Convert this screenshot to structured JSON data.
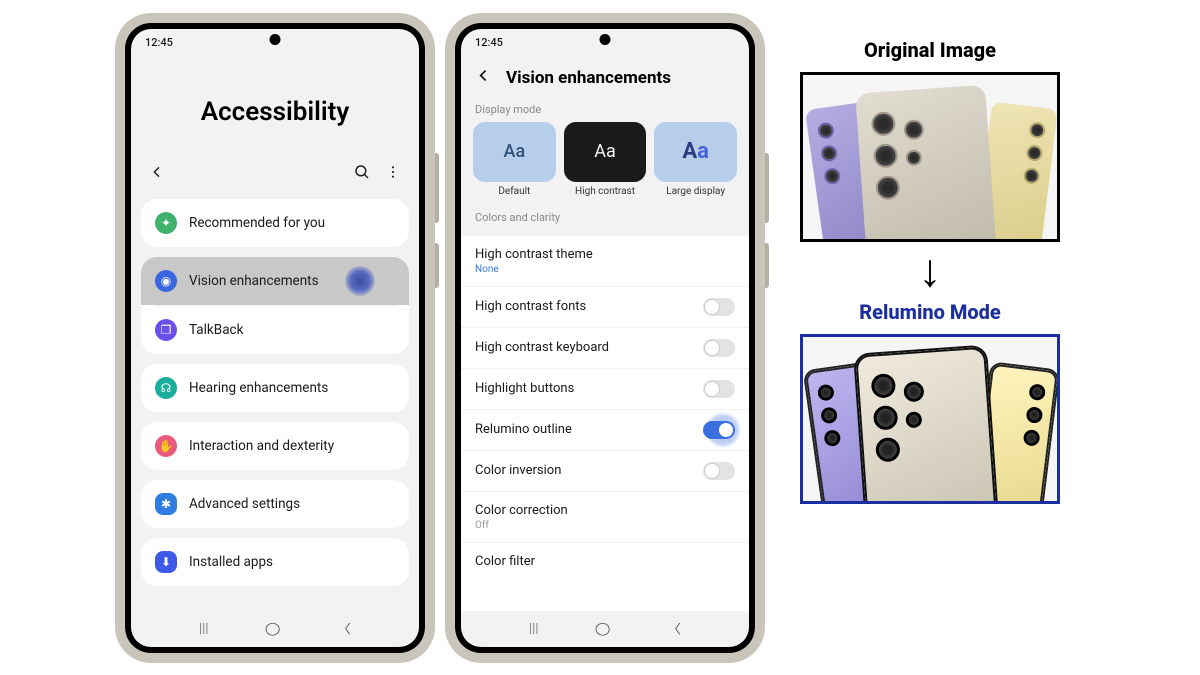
{
  "status_time": "12:45",
  "screen1": {
    "title": "Accessibility",
    "items": [
      {
        "label": "Recommended for you"
      },
      {
        "label": "Vision enhancements"
      },
      {
        "label": "TalkBack"
      },
      {
        "label": "Hearing enhancements"
      },
      {
        "label": "Interaction and dexterity"
      },
      {
        "label": "Advanced settings"
      },
      {
        "label": "Installed apps"
      }
    ]
  },
  "screen2": {
    "title": "Vision enhancements",
    "display_mode_label": "Display mode",
    "modes": {
      "default": "Default",
      "high_contrast": "High contrast",
      "large_display": "Large display"
    },
    "colors_label": "Colors and clarity",
    "rows": {
      "theme_label": "High contrast theme",
      "theme_value": "None",
      "fonts": "High contrast fonts",
      "keyboard": "High contrast keyboard",
      "highlight": "Highlight buttons",
      "relumino": "Relumino outline",
      "inversion": "Color inversion",
      "correction_label": "Color correction",
      "correction_value": "Off",
      "filter": "Color filter"
    }
  },
  "compare": {
    "original": "Original Image",
    "relumino": "Relumino Mode"
  }
}
